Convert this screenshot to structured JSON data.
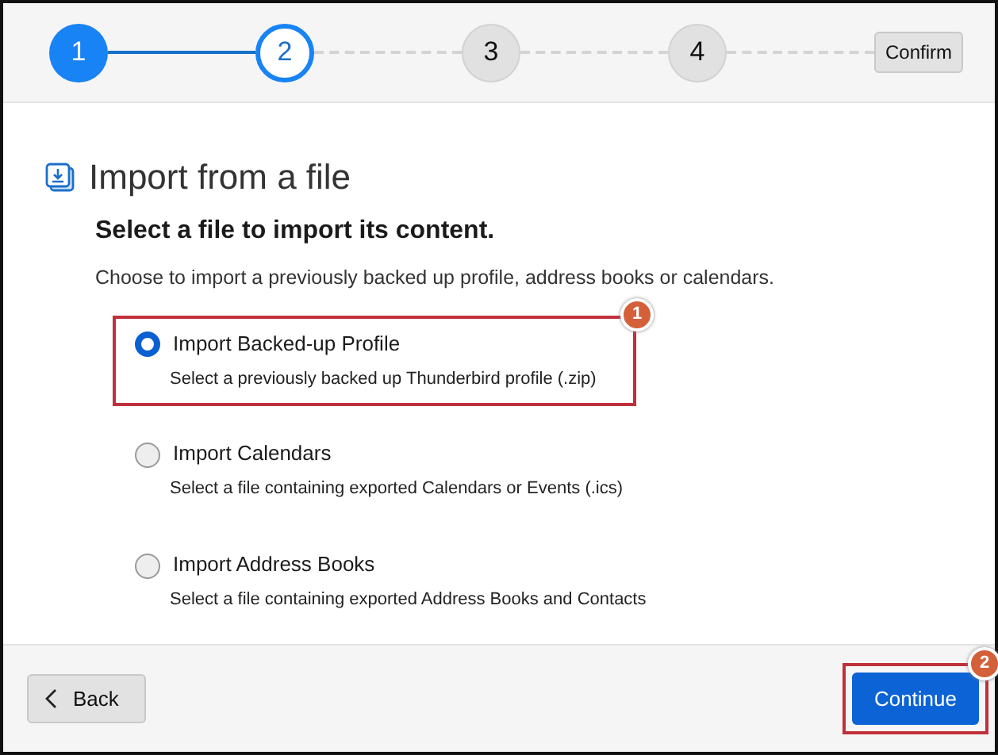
{
  "steps": [
    {
      "label": "1",
      "completed": true,
      "selected": false
    },
    {
      "label": "2",
      "completed": false,
      "selected": true
    },
    {
      "label": "3",
      "completed": false,
      "selected": false
    },
    {
      "label": "4",
      "completed": false,
      "selected": false
    }
  ],
  "confirm_button": "Confirm",
  "title": "Import from a file",
  "subtitle": "Select a file to import its content.",
  "description": "Choose to import a previously backed up profile, address books or calendars.",
  "options": [
    {
      "label": "Import Backed-up Profile",
      "hint": "Select a previously backed up Thunderbird profile (.zip)",
      "selected": true,
      "callout": "1"
    },
    {
      "label": "Import Calendars",
      "hint": "Select a file containing exported Calendars or Events (.ics)",
      "selected": false
    },
    {
      "label": "Import Address Books",
      "hint": "Select a file containing exported Address Books and Contacts",
      "selected": false
    }
  ],
  "back_button": "Back",
  "continue_button": {
    "label": "Continue",
    "callout": "2"
  }
}
